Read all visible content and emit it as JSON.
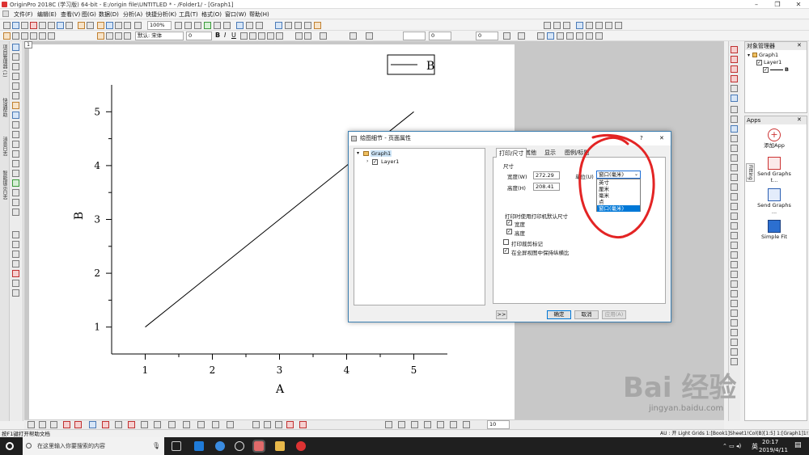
{
  "app": {
    "title": "OriginPro 2018C (学习版) 64-bit - E:/origin file\\UNTITLED * - /Folder1/ - [Graph1]"
  },
  "menu": [
    "文件(F)",
    "编辑(E)",
    "查看(V)",
    "图(G)",
    "数据(D)",
    "分析(A)",
    "快捷分析(K)",
    "工具(T)",
    "格式(O)",
    "窗口(W)",
    "帮助(H)"
  ],
  "toolbar": {
    "zoom": "100%",
    "font_name": "默认: 宋体",
    "font_size": "0",
    "line_width": "0",
    "size_field": "0",
    "bottom_size": "10"
  },
  "left_dock": [
    "项目管理器 (1)",
    "快速帮助",
    "消息日志",
    "智能提示日志"
  ],
  "graph": {
    "layer_tab": "1",
    "xlabel": "A",
    "ylabel": "B",
    "legend": "B",
    "xticks": [
      "1",
      "2",
      "3",
      "4",
      "5"
    ],
    "yticks": [
      "1",
      "2",
      "3",
      "4",
      "5"
    ]
  },
  "chart_data": {
    "type": "line",
    "title": "",
    "xlabel": "A",
    "ylabel": "B",
    "x": [
      1,
      2,
      3,
      4,
      5
    ],
    "series": [
      {
        "name": "B",
        "values": [
          1,
          2,
          3,
          4,
          5
        ]
      }
    ],
    "xlim": [
      0.5,
      5.5
    ],
    "ylim": [
      0.5,
      5.5
    ],
    "grid": false,
    "legend_position": "top-right"
  },
  "object_manager": {
    "title": "对象管理器",
    "graph": "Graph1",
    "layer": "Layer1",
    "plot": "B"
  },
  "apps": {
    "title": "Apps",
    "items": [
      "添加App",
      "Send Graphs t...",
      "Send Graphs ...",
      "Simple Fit"
    ],
    "side_tab": "Fitting"
  },
  "dialog": {
    "title": "绘图细节 - 页面属性",
    "help": "?",
    "close": "✕",
    "tree": {
      "root": "Graph1",
      "child": "Layer1"
    },
    "tabs": [
      "打印/尺寸",
      "其他",
      "显示",
      "图例/标题"
    ],
    "size_group": "尺寸",
    "width_label": "宽度(W)",
    "width_value": "272.29",
    "height_label": "高度(H)",
    "height_value": "208.41",
    "unit_label": "单位(U)",
    "unit_selected": "窗口(毫米)",
    "unit_options": [
      "英寸",
      "厘米",
      "毫米",
      "点",
      "窗口(毫米)"
    ],
    "print_group": "打印时使用打印机默认尺寸",
    "chk_width": "宽度",
    "chk_height": "高度",
    "chk_crop": "打印裁剪标记",
    "chk_aspect": "在全屏视图中保持纵横比",
    "expand": ">>",
    "ok": "确定",
    "cancel": "取消",
    "apply": "应用(A)"
  },
  "status": {
    "left": "按F1键打开帮助文档",
    "right": "AU : 开  Light Grids  1:[Book1]Sheet1!Col(B)[1:5]  1:[Graph1]1!1  弧度"
  },
  "taskbar": {
    "search": "在这里输入你要搜索的内容",
    "time": "20:17",
    "date": "2019/4/11",
    "ime": "英"
  },
  "watermark": {
    "text": "Bai 经验",
    "url": "jingyan.baidu.com"
  },
  "colors": {
    "annotation": "#e32424",
    "selection": "#0078d7",
    "accent": "#3c7fb1"
  }
}
